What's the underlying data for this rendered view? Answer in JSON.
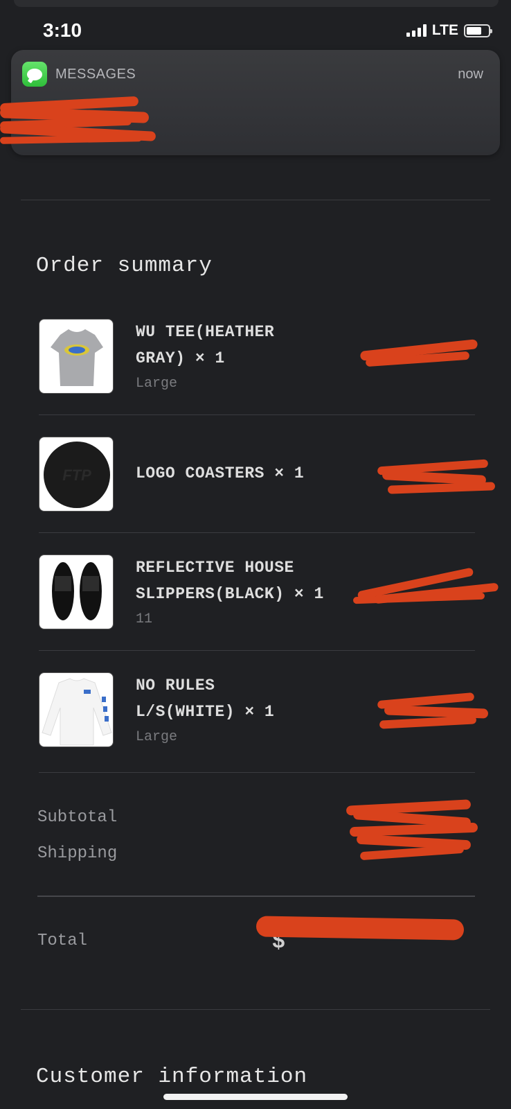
{
  "status_bar": {
    "time": "3:10",
    "network": "LTE"
  },
  "notification": {
    "app": "MESSAGES",
    "time": "now",
    "app_icon": "messages-bubble-icon",
    "accent": "#3fd14a"
  },
  "order_summary": {
    "title": "Order summary",
    "items": [
      {
        "name_line1": "WU TEE(HEATHER",
        "name_line2": "GRAY) × 1",
        "variant": "Large",
        "thumbnail": "heather-gray-tee"
      },
      {
        "name_line1": "LOGO COASTERS × 1",
        "name_line2": "",
        "variant": "",
        "thumbnail": "black-coaster"
      },
      {
        "name_line1": "REFLECTIVE HOUSE",
        "name_line2": "SLIPPERS(BLACK) × 1",
        "variant": "11",
        "thumbnail": "black-slippers"
      },
      {
        "name_line1": "NO RULES",
        "name_line2": "L/S(WHITE) × 1",
        "variant": "Large",
        "thumbnail": "white-long-sleeve"
      }
    ],
    "subtotal_label": "Subtotal",
    "shipping_label": "Shipping",
    "total_label": "Total",
    "total_value_visible": "$"
  },
  "customer_information": {
    "title": "Customer information"
  },
  "colors": {
    "background": "#1f2023",
    "redaction": "#d9421c"
  }
}
